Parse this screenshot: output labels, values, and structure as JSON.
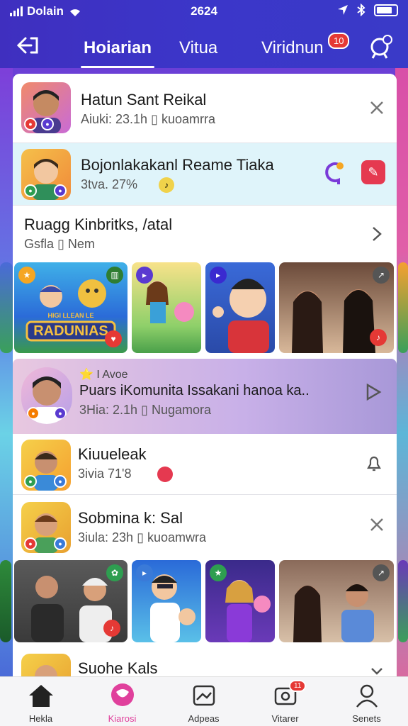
{
  "status": {
    "carrier": "Dolain",
    "time": "2624"
  },
  "nav": {
    "tabs": [
      {
        "label": "Hoiarian",
        "active": true
      },
      {
        "label": "Vitua"
      },
      {
        "label": "Viridnun",
        "badge": "10"
      }
    ]
  },
  "rows": [
    {
      "title": "Hatun Sant Reikal",
      "sub": "Aiuki: 23.1h ▯ kuoamrra"
    },
    {
      "title": "Bojonlakakanl Reame Tiaka",
      "sub": "3tva. 27%"
    },
    {
      "title": "Ruagg Kinbritks, /atal",
      "sub": "Gsfla ▯ Nem"
    },
    {
      "label": "⭐ I Avoe",
      "title": "Puars iKomunita Issakani hanoa ka..",
      "sub": "3Hia: 2.1h ▯ Nugamora"
    },
    {
      "title": "Kiuueleak",
      "sub": "3ivia 71'8"
    },
    {
      "title": "Sobmina k: Sal",
      "sub": "3iula: 23h ▯ kuoamwra"
    },
    {
      "title": "Suohe Kals"
    }
  ],
  "thumb_texts": {
    "banner": "RADUNIAS",
    "banner_small": "HIGI LLEAN LE"
  },
  "bottom_nav": [
    {
      "label": "Hekla",
      "icon": "home-icon"
    },
    {
      "label": "Kiarosi",
      "icon": "chat-icon",
      "active": true
    },
    {
      "label": "Adpeas",
      "icon": "image-icon"
    },
    {
      "label": "Vitarer",
      "icon": "camera-icon",
      "badge": "11"
    },
    {
      "label": "Senets",
      "icon": "person-icon"
    }
  ],
  "colors": {
    "accent": "#3b36c9",
    "highlight_row": "#dff4fa",
    "active_tab": "#e0409c",
    "badge": "#e53935"
  }
}
